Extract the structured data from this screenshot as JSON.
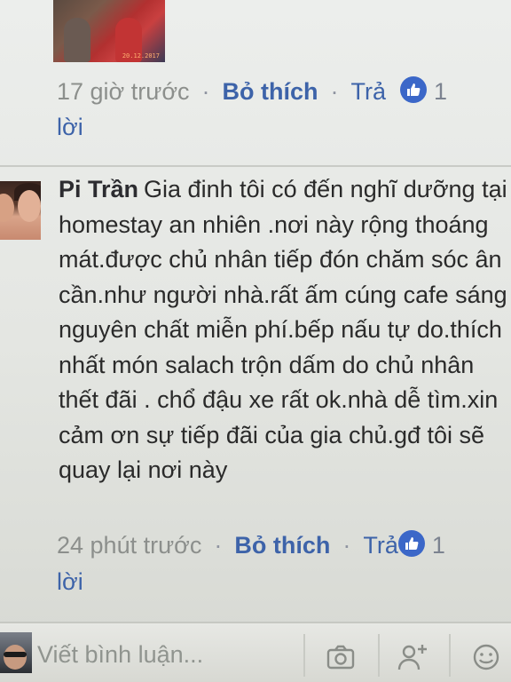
{
  "previous_comment": {
    "photo_date_stamp": "20.12.2017",
    "time": "17 giờ trước",
    "like_label": "Bỏ thích",
    "reply_label": "Trả",
    "reply_wrap": "lời",
    "like_count": "1"
  },
  "comment": {
    "author": "Pi Trần",
    "text": "Gia đinh tôi có đến nghĩ dưỡng tại homestay an nhiên .nơi này rộng thoáng mát.được chủ nhân tiếp đón chăm sóc ân cần.như người nhà.rất ấm cúng cafe sáng nguyên chất miễn phí.bếp nấu tự do.thích nhất món salach trộn dấm do chủ nhân thết đãi . chổ đậu xe rất ok.nhà dễ tìm.xin cảm ơn sự tiếp đãi của gia chủ.gđ tôi sẽ quay lại nơi này",
    "time": "24 phút trước",
    "like_label": "Bỏ thích",
    "reply_label": "Trả",
    "reply_wrap": "lời",
    "like_count": "1"
  },
  "composer": {
    "placeholder": "Viết bình luận...",
    "icons": [
      "camera-icon",
      "google-plus-icon",
      "smiley-icon"
    ]
  },
  "colors": {
    "link": "#3d63a9",
    "like_badge": "#3b67c8",
    "meta_text": "#8c8f8c"
  }
}
